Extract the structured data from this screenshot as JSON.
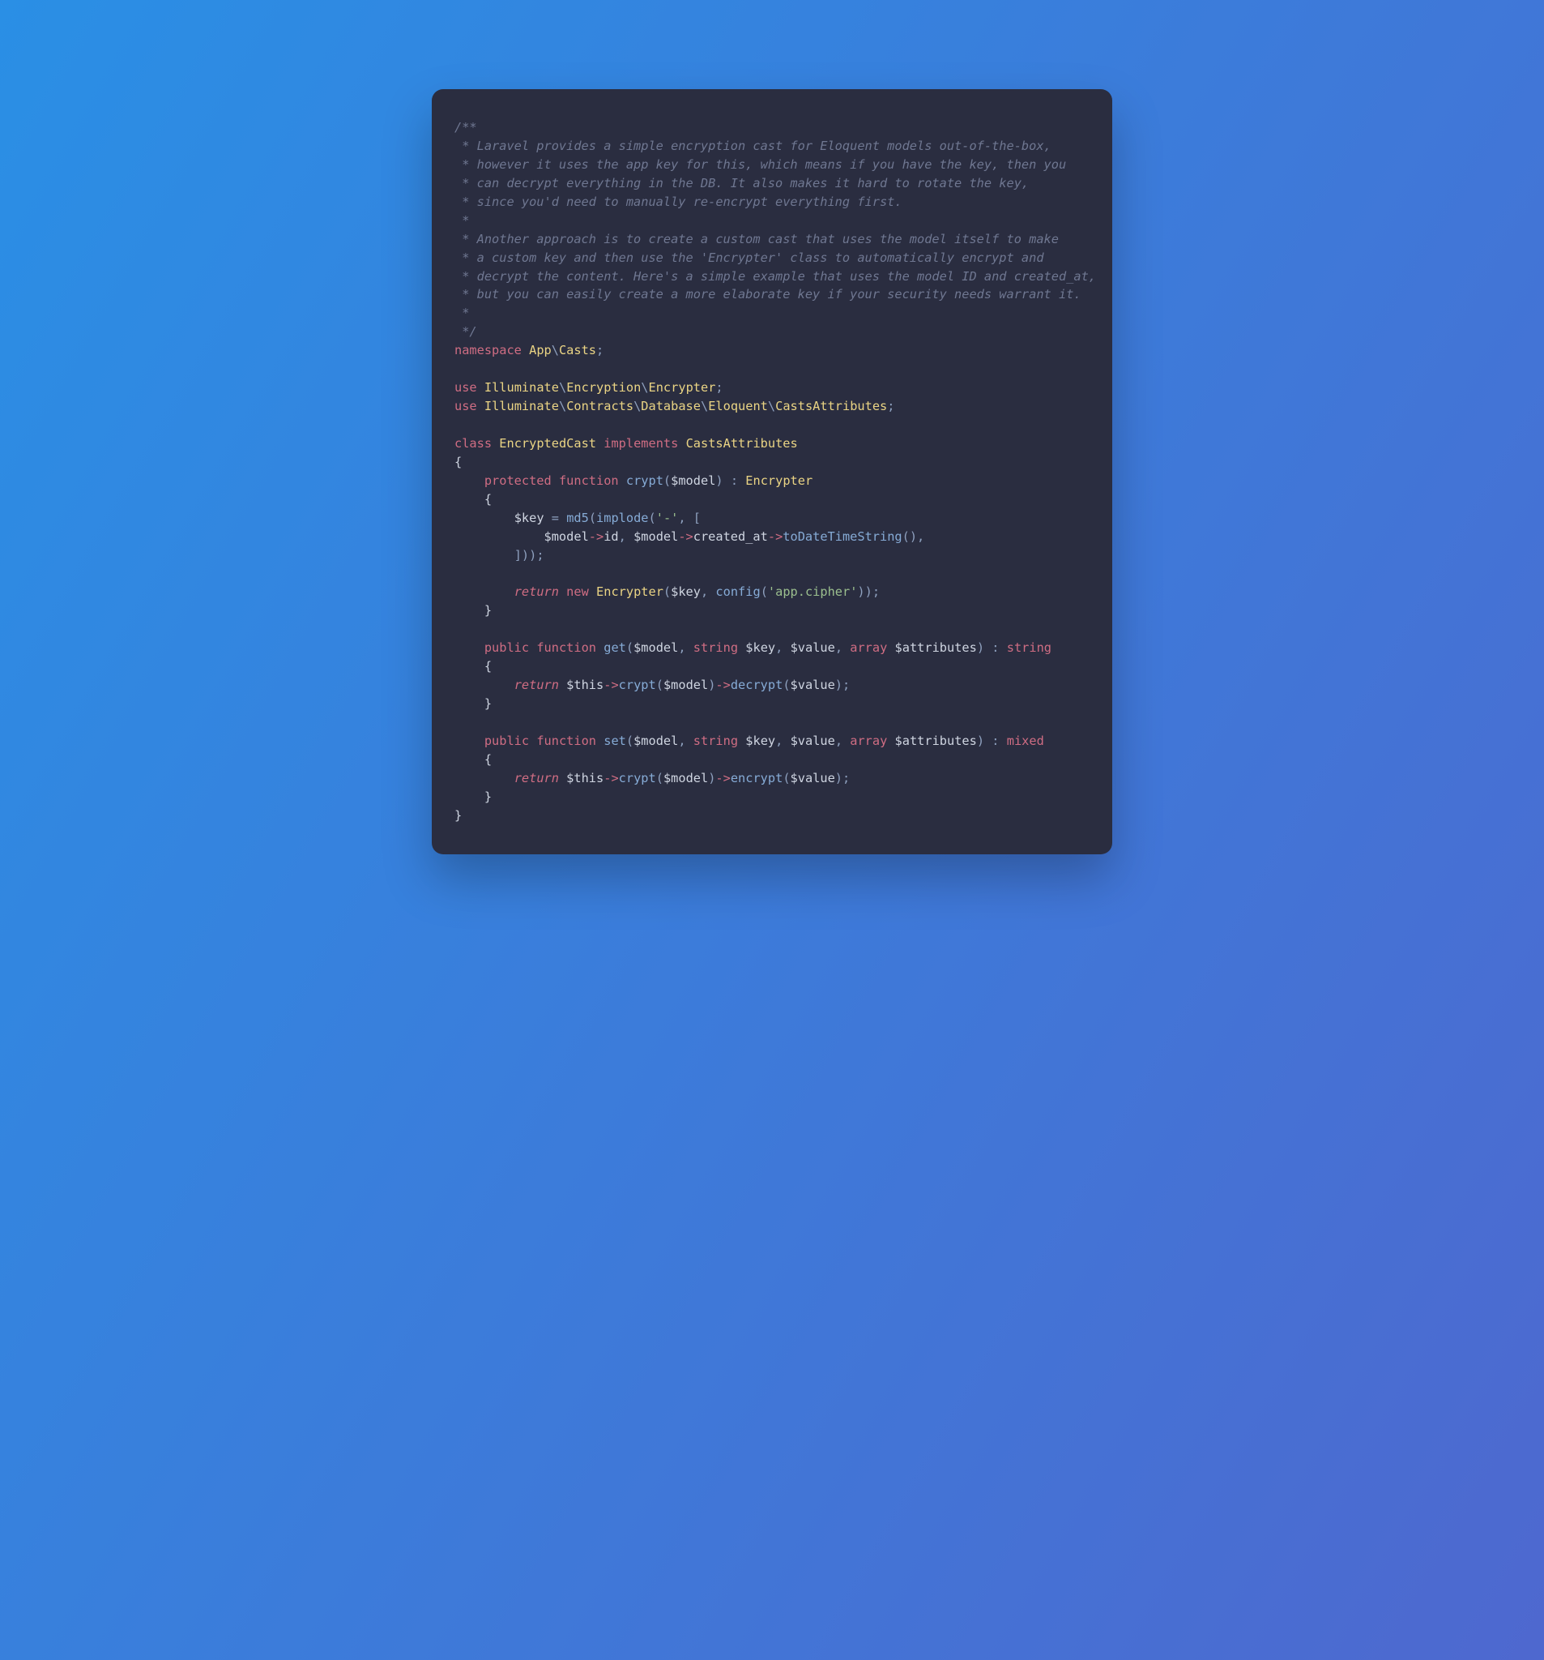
{
  "comment": {
    "l1": "/**",
    "l2": " * Laravel provides a simple encryption cast for Eloquent models out-of-the-box,",
    "l3": " * however it uses the app key for this, which means if you have the key, then you",
    "l4": " * can decrypt everything in the DB. It also makes it hard to rotate the key,",
    "l5": " * since you'd need to manually re-encrypt everything first.",
    "l6": " *",
    "l7": " * Another approach is to create a custom cast that uses the model itself to make",
    "l8": " * a custom key and then use the 'Encrypter' class to automatically encrypt and",
    "l9": " * decrypt the content. Here's a simple example that uses the model ID and created_at,",
    "l10": " * but you can easily create a more elaborate key if your security needs warrant it.",
    "l11": " *",
    "l12": " */"
  },
  "kw": {
    "namespace": "namespace",
    "use": "use",
    "class": "class",
    "implements": "implements",
    "protected": "protected",
    "public": "public",
    "function": "function",
    "return": "return",
    "new": "new",
    "string": "string",
    "array": "array",
    "mixed": "mixed"
  },
  "ns": {
    "app": "App",
    "casts": "Casts",
    "illuminate": "Illuminate",
    "encryption": "Encryption",
    "encrypter": "Encrypter",
    "contracts": "Contracts",
    "database": "Database",
    "eloquent": "Eloquent",
    "castsattrs": "CastsAttributes",
    "classname": "EncryptedCast"
  },
  "fn": {
    "crypt": "crypt",
    "md5": "md5",
    "implode": "implode",
    "toDateTimeString": "toDateTimeString",
    "config": "config",
    "get": "get",
    "set": "set",
    "decrypt": "decrypt",
    "encrypt": "encrypt"
  },
  "var": {
    "model": "$model",
    "key": "$key",
    "value": "$value",
    "attributes": "$attributes",
    "this": "$this"
  },
  "str": {
    "dash": "'-'",
    "cipher": "'app.cipher'"
  },
  "prop": {
    "id": "id",
    "created_at": "created_at"
  }
}
